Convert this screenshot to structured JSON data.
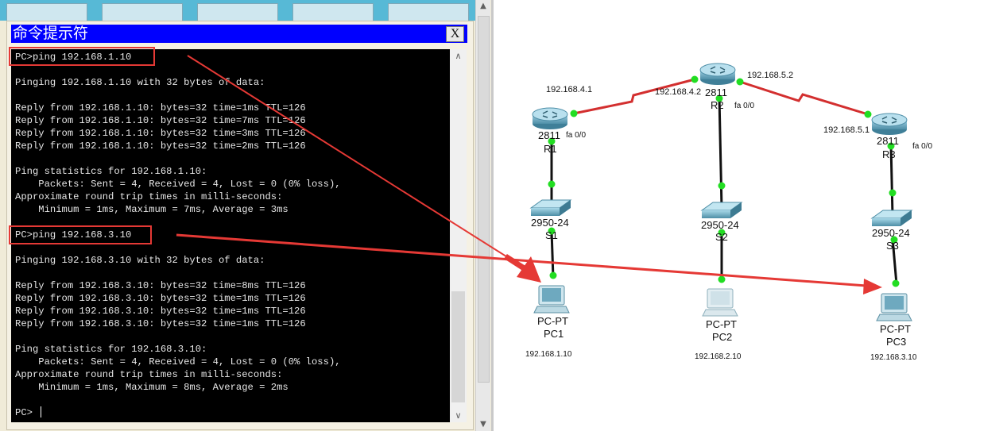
{
  "cmd_window": {
    "title": "命令提示符",
    "close_label": "X",
    "terminal_lines": [
      "PC>ping 192.168.1.10",
      "",
      "Pinging 192.168.1.10 with 32 bytes of data:",
      "",
      "Reply from 192.168.1.10: bytes=32 time=1ms TTL=126",
      "Reply from 192.168.1.10: bytes=32 time=7ms TTL=126",
      "Reply from 192.168.1.10: bytes=32 time=3ms TTL=126",
      "Reply from 192.168.1.10: bytes=32 time=2ms TTL=126",
      "",
      "Ping statistics for 192.168.1.10:",
      "    Packets: Sent = 4, Received = 4, Lost = 0 (0% loss),",
      "Approximate round trip times in milli-seconds:",
      "    Minimum = 1ms, Maximum = 7ms, Average = 3ms",
      "",
      "PC>ping 192.168.3.10",
      "",
      "Pinging 192.168.3.10 with 32 bytes of data:",
      "",
      "Reply from 192.168.3.10: bytes=32 time=8ms TTL=126",
      "Reply from 192.168.3.10: bytes=32 time=1ms TTL=126",
      "Reply from 192.168.3.10: bytes=32 time=1ms TTL=126",
      "Reply from 192.168.3.10: bytes=32 time=1ms TTL=126",
      "",
      "Ping statistics for 192.168.3.10:",
      "    Packets: Sent = 4, Received = 4, Lost = 0 (0% loss),",
      "Approximate round trip times in milli-seconds:",
      "    Minimum = 1ms, Maximum = 8ms, Average = 2ms",
      "",
      "PC>"
    ]
  },
  "topology": {
    "routers": {
      "r1": {
        "model": "2811",
        "name": "R1",
        "port": "fa 0/0"
      },
      "r2": {
        "model": "2811",
        "name": "R2",
        "port": "fa 0/0"
      },
      "r3": {
        "model": "2811",
        "name": "R3",
        "port": "fa 0/0"
      }
    },
    "switches": {
      "s1": {
        "model": "2950-24",
        "name": "S1"
      },
      "s2": {
        "model": "2950-24",
        "name": "S2"
      },
      "s3": {
        "model": "2950-24",
        "name": "S3"
      }
    },
    "pcs": {
      "pc1": {
        "type": "PC-PT",
        "name": "PC1",
        "ip": "192.168.1.10"
      },
      "pc2": {
        "type": "PC-PT",
        "name": "PC2",
        "ip": "192.168.2.10"
      },
      "pc3": {
        "type": "PC-PT",
        "name": "PC3",
        "ip": "192.168.3.10"
      }
    },
    "links": {
      "r1_wan_ip": "192.168.4.1",
      "r2_wan_ip_left": "192.168.4.2",
      "r2_wan_ip_right": "192.168.5.2",
      "r3_wan_ip": "192.168.5.1"
    }
  },
  "colors": {
    "terminal_bg": "#000000",
    "title_bar": "#0000ff",
    "serial_link": "#d32f2f",
    "annotation": "#e53935",
    "link_light": "#22dd22"
  }
}
